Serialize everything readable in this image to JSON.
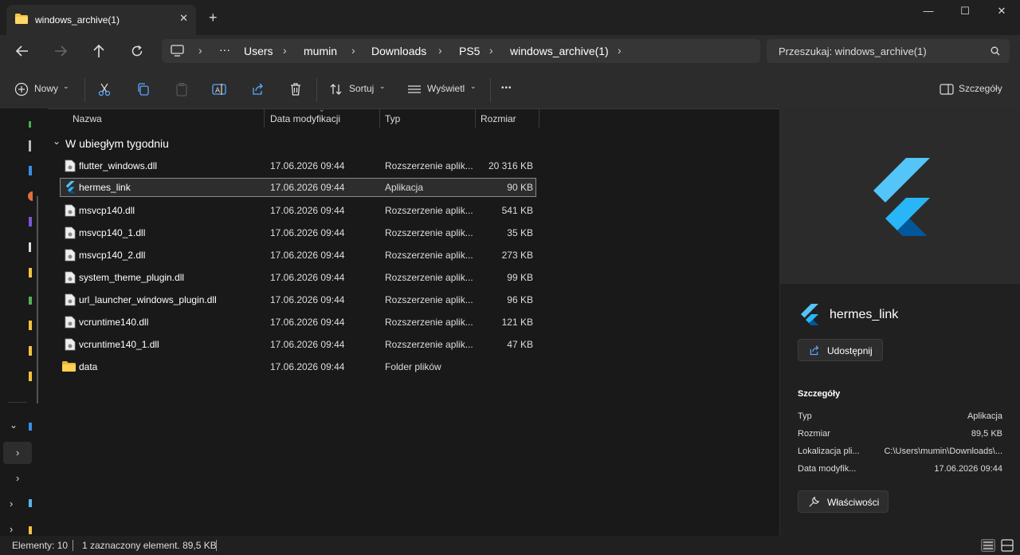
{
  "window": {
    "tab_title": "windows_archive(1)",
    "tab_close": "✕",
    "new_tab": "+",
    "minimize": "—",
    "maximize": "☐",
    "close": "✕"
  },
  "nav": {
    "back_icon": "arrow-left-icon",
    "forward_icon": "arrow-right-icon",
    "up_icon": "arrow-up-icon",
    "refresh_icon": "refresh-icon"
  },
  "breadcrumb": {
    "more": "···",
    "items": [
      "Users",
      "mumin",
      "Downloads",
      "PS5",
      "windows_archive(1)"
    ],
    "separator": "›"
  },
  "search": {
    "placeholder": "Przeszukaj: windows_archive(1)"
  },
  "toolbar": {
    "new_label": "Nowy",
    "sort_label": "Sortuj",
    "view_label": "Wyświetl",
    "more": "•••",
    "details_label": "Szczegóły"
  },
  "columns": {
    "name": "Nazwa",
    "date": "Data modyfikacji",
    "type": "Typ",
    "size": "Rozmiar"
  },
  "group": {
    "label": "W ubiegłym tygodniu"
  },
  "files": [
    {
      "name": "flutter_windows.dll",
      "date": "17.06.2026 09:44",
      "type": "Rozszerzenie aplik...",
      "size": "20 316 KB"
    },
    {
      "name": "hermes_link",
      "date": "17.06.2026 09:44",
      "type": "Aplikacja",
      "size": "90 KB"
    },
    {
      "name": "msvcp140.dll",
      "date": "17.06.2026 09:44",
      "type": "Rozszerzenie aplik...",
      "size": "541 KB"
    },
    {
      "name": "msvcp140_1.dll",
      "date": "17.06.2026 09:44",
      "type": "Rozszerzenie aplik...",
      "size": "35 KB"
    },
    {
      "name": "msvcp140_2.dll",
      "date": "17.06.2026 09:44",
      "type": "Rozszerzenie aplik...",
      "size": "273 KB"
    },
    {
      "name": "system_theme_plugin.dll",
      "date": "17.06.2026 09:44",
      "type": "Rozszerzenie aplik...",
      "size": "99 KB"
    },
    {
      "name": "url_launcher_windows_plugin.dll",
      "date": "17.06.2026 09:44",
      "type": "Rozszerzenie aplik...",
      "size": "96 KB"
    },
    {
      "name": "vcruntime140.dll",
      "date": "17.06.2026 09:44",
      "type": "Rozszerzenie aplik...",
      "size": "121 KB"
    },
    {
      "name": "vcruntime140_1.dll",
      "date": "17.06.2026 09:44",
      "type": "Rozszerzenie aplik...",
      "size": "47 KB"
    },
    {
      "name": "data",
      "date": "17.06.2026 09:44",
      "type": "Folder plików",
      "size": ""
    }
  ],
  "details": {
    "file_name": "hermes_link",
    "share_label": "Udostępnij",
    "section_title": "Szczegóły",
    "rows": [
      {
        "key": "Typ",
        "value": "Aplikacja"
      },
      {
        "key": "Rozmiar",
        "value": "89,5 KB"
      },
      {
        "key": "Lokalizacja pli...",
        "value": "C:\\Users\\mumin\\Downloads\\..."
      },
      {
        "key": "Data modyfik...",
        "value": "17.06.2026 09:44"
      }
    ],
    "properties_label": "Właściwości"
  },
  "status": {
    "count": "Elementy: 10",
    "selection": "1 zaznaczony element. 89,5 KB"
  },
  "colors": {
    "flutter_light": "#54c5f8",
    "flutter_dark": "#01579b",
    "folder": "#f5c242",
    "selection_border": "#8a8a8a"
  }
}
